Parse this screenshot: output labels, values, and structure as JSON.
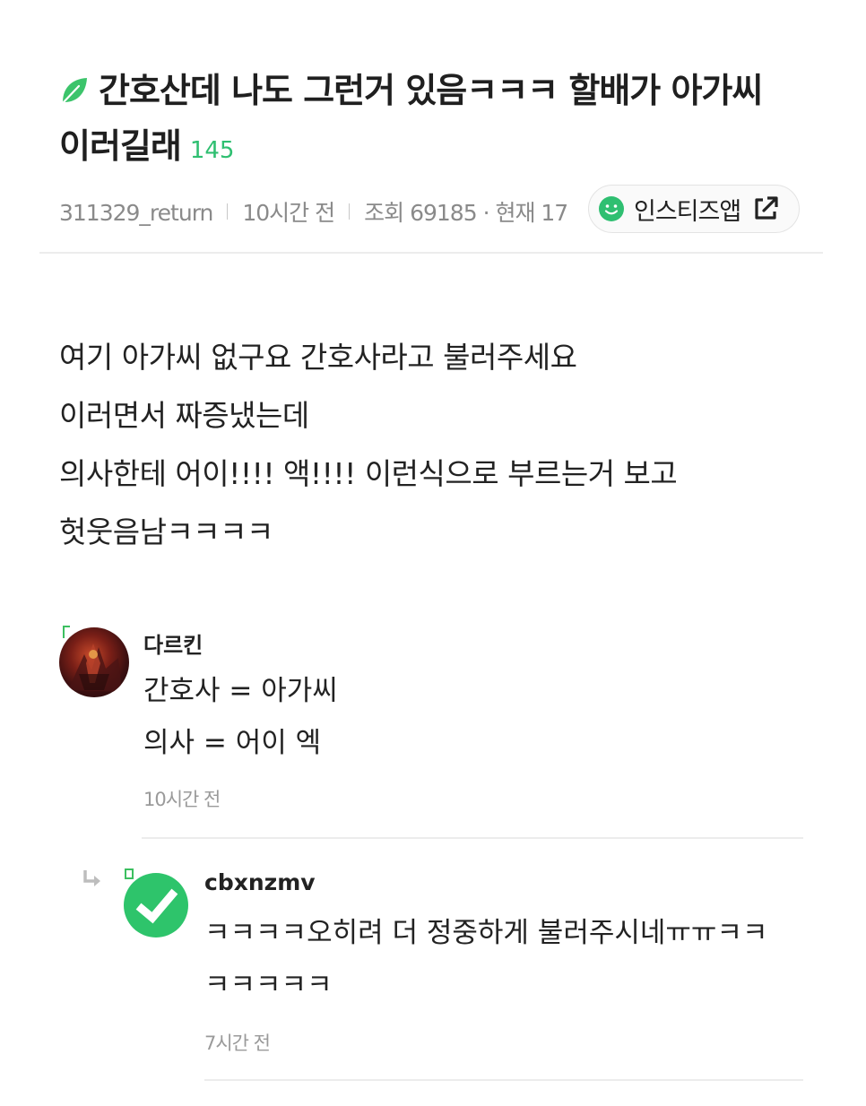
{
  "post": {
    "title_line1": "간호산데 나도 그런거 있음ㅋㅋㅋ 할배가 아가씨",
    "title_line2": "이러길래",
    "comment_count": "145",
    "leaf_icon": "leaf-icon",
    "author": "311329_return",
    "time": "10시간 전",
    "views": "조회 69185 · 현재 17",
    "app_button_label": "인스티즈앱",
    "app_icon": "smile-icon",
    "external_icon": "external-link-icon",
    "body_lines": [
      "여기 아가씨 없구요 간호사라고 불러주세요",
      "이러면서 짜증냈는데",
      "의사한테 어이!!!! 액!!!! 이런식으로 부르는거 보고",
      "헛웃음남ㅋㅋㅋㅋ"
    ]
  },
  "comments": [
    {
      "name": "다르킨",
      "lines": [
        "간호사 = 아가씨",
        "의사 = 어이 엑"
      ],
      "time": "10시간 전"
    },
    {
      "name": "cbxnzmv",
      "lines": [
        "ㅋㅋㅋㅋ오히려 더 정중하게 불러주시네ㅠㅠㅋㅋ",
        "ㅋㅋㅋㅋㅋ"
      ],
      "time": "7시간 전",
      "is_reply": true
    }
  ],
  "colors": {
    "accent_green": "#2fbf71",
    "text": "#222222",
    "muted": "#8a8a8a"
  }
}
